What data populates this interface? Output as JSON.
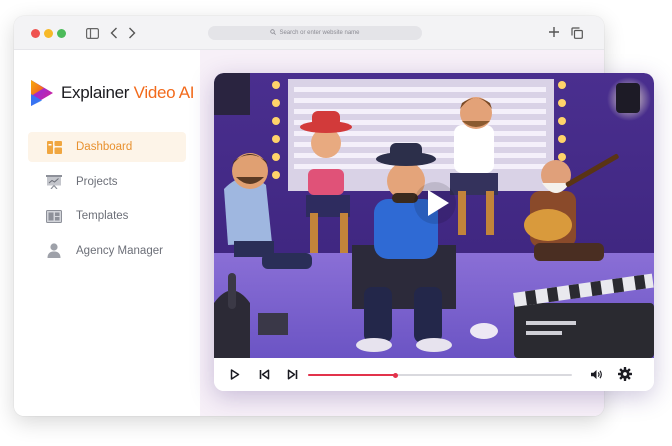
{
  "browser": {
    "address_placeholder": "Search or enter website name",
    "icons": [
      "sidebar-toggle-icon",
      "back-arrow-icon",
      "forward-arrow-icon",
      "search-icon",
      "plus-icon",
      "copy-tabs-icon"
    ]
  },
  "app": {
    "logo_prefix": "Explainer ",
    "logo_accent": "Video AI",
    "accent_color": "#f26a1b"
  },
  "sidebar": {
    "items": [
      {
        "label": "Dashboard",
        "icon": "dashboard-icon",
        "active": true
      },
      {
        "label": "Projects",
        "icon": "presentation-icon",
        "active": false
      },
      {
        "label": "Templates",
        "icon": "templates-icon",
        "active": false
      },
      {
        "label": "Agency Manager",
        "icon": "user-icon",
        "active": false
      }
    ]
  },
  "player": {
    "progress": 0.33,
    "progress_color": "#e2324b",
    "controls": [
      "play-icon",
      "skip-back-icon",
      "skip-forward-icon",
      "volume-icon",
      "settings-icon"
    ]
  }
}
